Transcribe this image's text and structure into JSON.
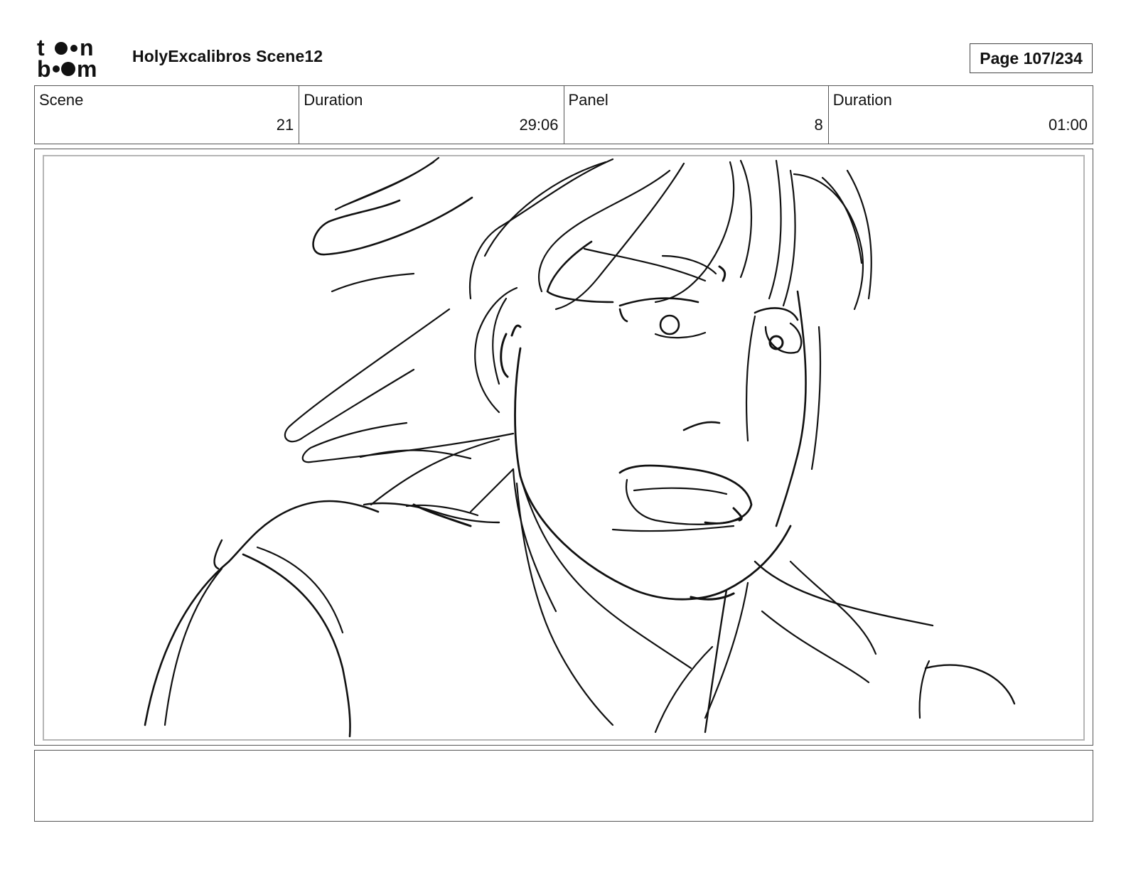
{
  "header": {
    "logo_text": "toon boom",
    "title": "HolyExcalibros Scene12",
    "page": "Page 107/234"
  },
  "info": [
    {
      "label": "Scene",
      "value": "21"
    },
    {
      "label": "Duration",
      "value": "29:06"
    },
    {
      "label": "Panel",
      "value": "8"
    },
    {
      "label": "Duration",
      "value": "01:00"
    }
  ],
  "panel": {
    "icon": "sketch-drawing"
  },
  "notes": {
    "text": ""
  }
}
